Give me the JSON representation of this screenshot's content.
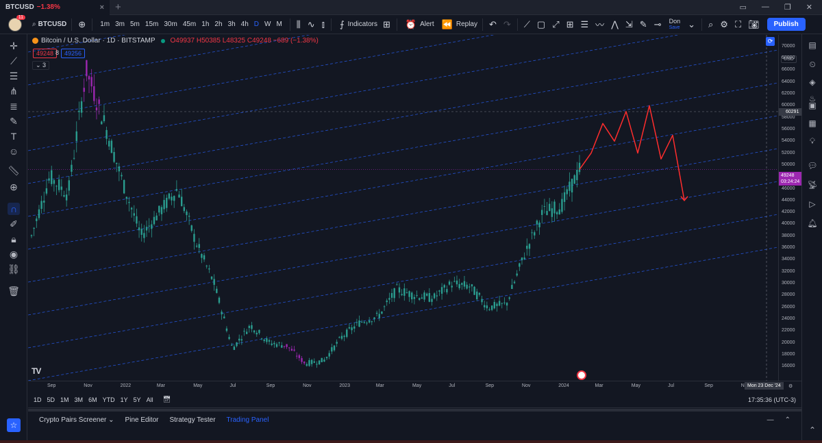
{
  "browser": {
    "tab_symbol": "BTCUSD",
    "tab_change": "−1.38%",
    "tab_close": "×",
    "new_tab": "+"
  },
  "toolbar": {
    "avatar_badge": "11",
    "symbol": "BTCUSD",
    "add_symbol": "+",
    "intervals": [
      "1m",
      "3m",
      "5m",
      "15m",
      "30m",
      "45m",
      "1h",
      "2h",
      "3h",
      "4h",
      "D",
      "W",
      "M"
    ],
    "active_interval": "D",
    "indicators_label": "Indicators",
    "alert_label": "Alert",
    "replay_label": "Replay",
    "layout_name": "Don",
    "save_label": "Save",
    "publish_label": "Publish"
  },
  "chart_header": {
    "title": "Bitcoin / U.S. Dollar · 1D · BITSTAMP",
    "open": "O49937",
    "high": "H50385",
    "low": "L48325",
    "close": "C49248",
    "change": "−689 (−1.38%)",
    "sell_price": "49248",
    "spread": "8",
    "buy_price": "49256",
    "indicators_count": "3"
  },
  "price_axis": {
    "currency": "USD",
    "labels": [
      "70000",
      "68000",
      "66000",
      "64000",
      "62000",
      "60000",
      "58000",
      "56000",
      "54000",
      "52000",
      "50000",
      "48000",
      "46000",
      "44000",
      "42000",
      "40000",
      "38000",
      "36000",
      "34000",
      "32000",
      "30000",
      "28000",
      "26000",
      "24000",
      "22000",
      "20000",
      "18000",
      "16000"
    ],
    "crosshair_price": "60291",
    "current_price": "49248",
    "countdown": "03:24:24"
  },
  "time_axis": {
    "labels": [
      "Sep",
      "Nov",
      "2022",
      "Mar",
      "May",
      "Jul",
      "Sep",
      "Nov",
      "2023",
      "Mar",
      "May",
      "Jul",
      "Sep",
      "Nov",
      "2024",
      "Mar",
      "May",
      "Jul",
      "Sep",
      "Nov"
    ],
    "crosshair_date": "Mon 23 Dec '24"
  },
  "range_bar": {
    "ranges": [
      "1D",
      "5D",
      "1M",
      "3M",
      "6M",
      "YTD",
      "1Y",
      "5Y",
      "All"
    ],
    "clock": "17:35:36 (UTC-3)"
  },
  "bottom_panel": {
    "tabs": [
      "Crypto Pairs Screener",
      "Pine Editor",
      "Strategy Tester",
      "Trading Panel"
    ],
    "active_tab": "Trading Panel"
  },
  "chart_data": {
    "type": "line",
    "x": [
      "2021-08",
      "2021-09",
      "2021-10",
      "2021-11",
      "2021-12",
      "2022-01",
      "2022-02",
      "2022-03",
      "2022-04",
      "2022-05",
      "2022-06",
      "2022-07",
      "2022-08",
      "2022-09",
      "2022-10",
      "2022-11",
      "2022-12",
      "2023-01",
      "2023-02",
      "2023-03",
      "2023-04",
      "2023-05",
      "2023-06",
      "2023-07",
      "2023-08",
      "2023-09",
      "2023-10",
      "2023-11",
      "2023-12",
      "2024-01",
      "2024-02"
    ],
    "series": [
      {
        "values": [
          38000,
          48000,
          45000,
          66000,
          57000,
          47000,
          38000,
          42000,
          46000,
          37000,
          30000,
          19000,
          23000,
          20000,
          19500,
          16500,
          17000,
          21000,
          23500,
          24500,
          29000,
          28000,
          27500,
          30000,
          29500,
          26000,
          26500,
          35000,
          42000,
          43000,
          49248
        ]
      }
    ],
    "projection": {
      "values": [
        49248,
        52000,
        57000,
        54000,
        59000,
        52000,
        60000,
        51000,
        55000,
        44000
      ]
    },
    "ylim": [
      15000,
      71000
    ],
    "colors": {
      "candles": "#2a9d8f",
      "projection": "#ff2d2d",
      "trendlines": "#2962ff",
      "purple": "#9c27b0"
    }
  }
}
